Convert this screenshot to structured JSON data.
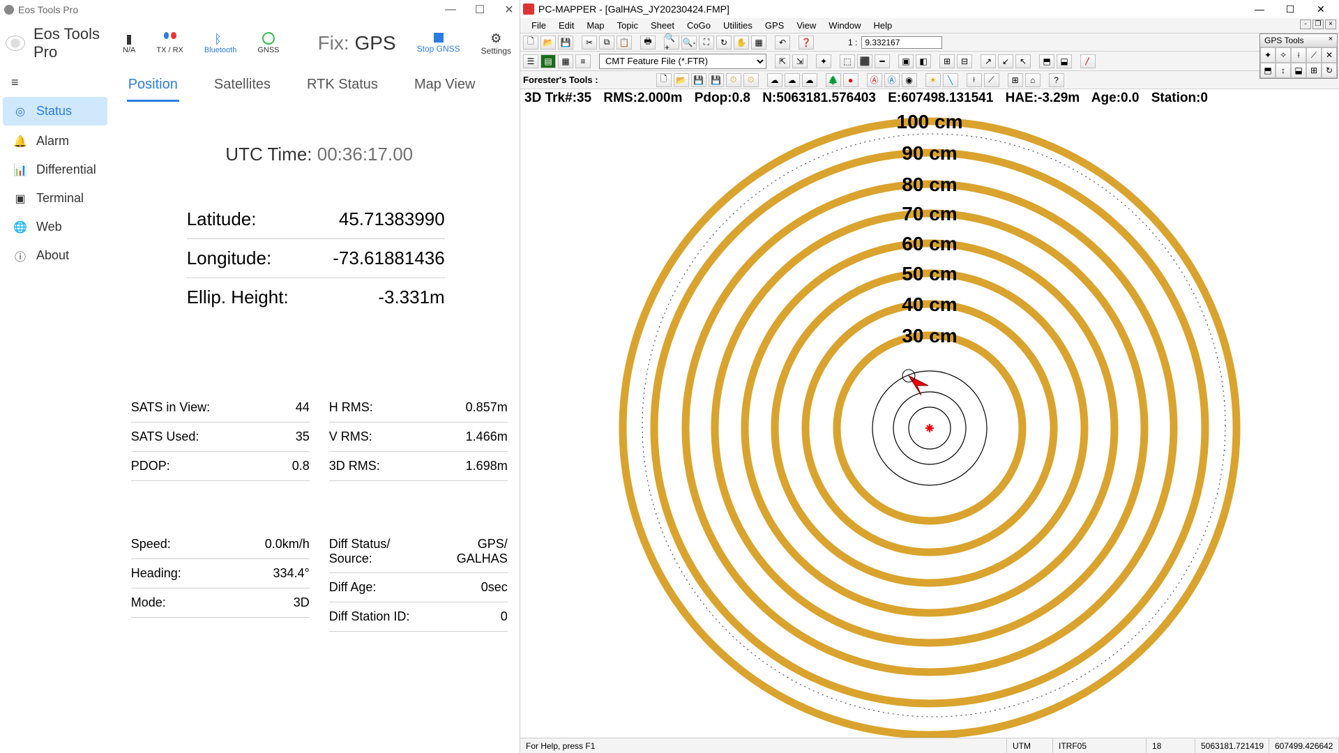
{
  "eos": {
    "title": "Eos Tools Pro",
    "appname": "Eos Tools Pro",
    "statusIcons": {
      "na": "N/A",
      "txrx": "TX / RX",
      "bluetooth": "Bluetooth",
      "gnss": "GNSS"
    },
    "fixLabel": "Fix:",
    "fixValue": "GPS",
    "stopLabel": "Stop GNSS",
    "settingsLabel": "Settings",
    "nav": {
      "status": "Status",
      "alarm": "Alarm",
      "differential": "Differential",
      "terminal": "Terminal",
      "web": "Web",
      "about": "About"
    },
    "tabs": {
      "position": "Position",
      "satellites": "Satellites",
      "rtk": "RTK Status",
      "map": "Map View"
    },
    "utcLabel": "UTC Time:",
    "utcValue": "00:36:17.00",
    "coords": {
      "latLabel": "Latitude:",
      "latValue": "45.71383990",
      "lonLabel": "Longitude:",
      "lonValue": "-73.61881436",
      "hgtLabel": "Ellip. Height:",
      "hgtValue": "-3.331m"
    },
    "stats1": {
      "satsViewL": "SATS in View:",
      "satsViewV": "44",
      "satsUsedL": "SATS Used:",
      "satsUsedV": "35",
      "pdopL": "PDOP:",
      "pdopV": "0.8"
    },
    "stats2": {
      "hrmsL": "H RMS:",
      "hrmsV": "0.857m",
      "vrmsL": "V RMS:",
      "vrmsV": "1.466m",
      "drmsL": "3D RMS:",
      "drmsV": "1.698m"
    },
    "stats3": {
      "speedL": "Speed:",
      "speedV": "0.0km/h",
      "headingL": "Heading:",
      "headingV": "334.4°",
      "modeL": "Mode:",
      "modeV": "3D"
    },
    "stats4": {
      "diffL1": "Diff Status/",
      "diffL2": "Source:",
      "diffV1": "GPS/",
      "diffV2": "GALHAS",
      "ageL": "Diff Age:",
      "ageV": "0sec",
      "stationL": "Diff Station ID:",
      "stationV": "0"
    }
  },
  "pcm": {
    "title": "PC-MAPPER - [GalHAS_JY20230424.FMP]",
    "menus": [
      "File",
      "Edit",
      "Map",
      "Topic",
      "Sheet",
      "CoGo",
      "Utilities",
      "GPS",
      "View",
      "Window",
      "Help"
    ],
    "scaleLabel": "1 :",
    "scaleValue": "9.332167",
    "featureFile": "CMT Feature File (*.FTR)",
    "foresterLabel": "Forester's Tools :",
    "statusLine": {
      "trk": "3D Trk#:35",
      "rms": "RMS:2.000m",
      "pdop": "Pdop:0.8",
      "n": "N:5063181.576403",
      "e": "E:607498.131541",
      "hae": "HAE:-3.29m",
      "age": "Age:0.0",
      "station": "Station:0"
    },
    "rings": [
      "100 cm",
      "90 cm",
      "80 cm",
      "70 cm",
      "60 cm",
      "50 cm",
      "40 cm",
      "30 cm"
    ],
    "gpsToolsTitle": "GPS Tools",
    "statusbar": {
      "help": "For Help, press F1",
      "proj": "UTM",
      "datum": "ITRF05",
      "zone": "18",
      "coordN": "5063181.721419",
      "coordE": "607499.426642"
    }
  }
}
